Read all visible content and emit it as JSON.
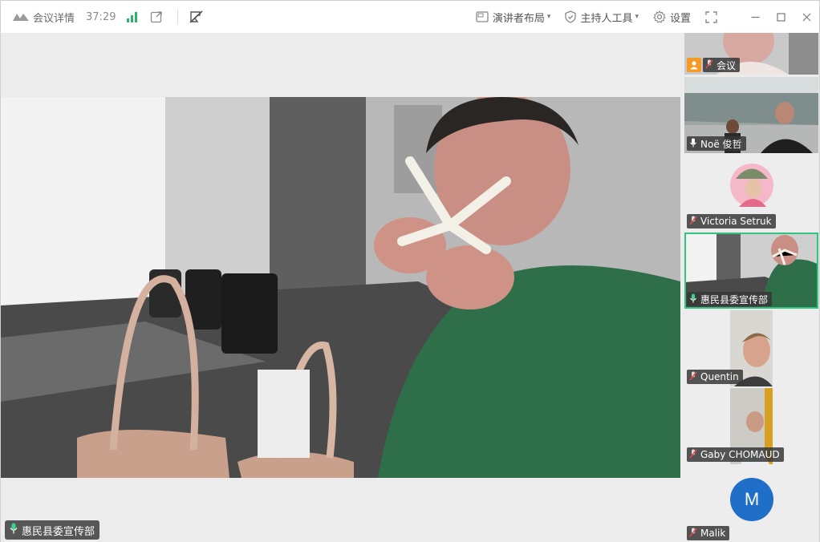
{
  "topbar": {
    "meeting_details": "会议详情",
    "timer": "37:29",
    "presenter_layout": "演讲者布局",
    "host_tools": "主持人工具",
    "settings": "设置"
  },
  "main": {
    "speaker_name": "惠民县委宣传部"
  },
  "sidebar": {
    "tiles": [
      {
        "name": "会议",
        "mic": "muted",
        "host": true
      },
      {
        "name": "Noë 俊哲",
        "mic": "on"
      },
      {
        "name": "Victoria Setruk",
        "mic": "muted"
      },
      {
        "name": "惠民县委宣传部",
        "mic": "speaking",
        "active": true
      },
      {
        "name": "Quentin",
        "mic": "muted"
      },
      {
        "name": "Gaby CHOMAUD",
        "mic": "muted"
      },
      {
        "name": "Malik",
        "mic": "muted",
        "avatar_letter": "M"
      }
    ]
  },
  "colors": {
    "accent_green": "#30c47f",
    "avatar_blue": "#1f6fc8",
    "host_orange": "#f59a23",
    "muted_red": "#e5484d"
  },
  "icons": [
    "logo-icon",
    "signal-icon",
    "share-icon",
    "no-video-icon",
    "layout-icon",
    "shield-icon",
    "gear-icon",
    "fullscreen-icon",
    "minimize-icon",
    "maximize-icon",
    "close-icon",
    "mic-icon",
    "mic-muted-icon",
    "user-icon"
  ]
}
